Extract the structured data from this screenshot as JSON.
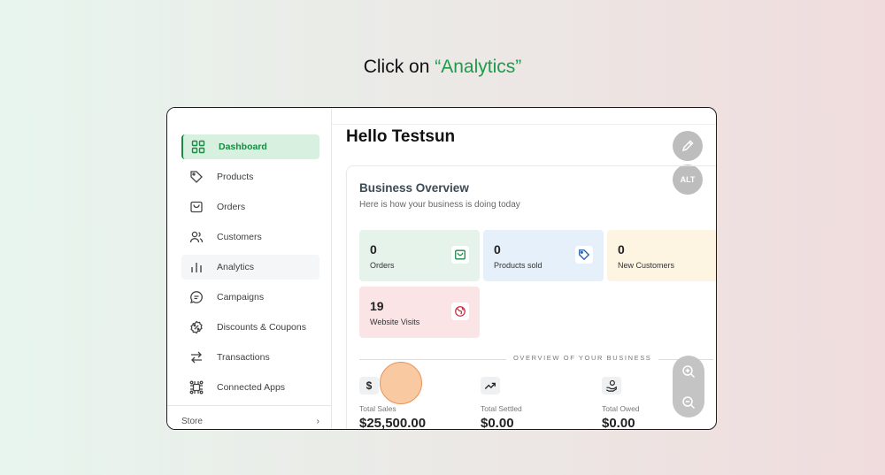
{
  "instruction": {
    "prefix": "Click on ",
    "target": "“Analytics”"
  },
  "sidebar": {
    "items": [
      {
        "label": "Dashboard",
        "icon": "grid-icon"
      },
      {
        "label": "Products",
        "icon": "tag-icon"
      },
      {
        "label": "Orders",
        "icon": "shopping-bag-icon"
      },
      {
        "label": "Customers",
        "icon": "users-icon"
      },
      {
        "label": "Analytics",
        "icon": "bar-chart-icon"
      },
      {
        "label": "Campaigns",
        "icon": "chat-bubble-icon"
      },
      {
        "label": "Discounts & Coupons",
        "icon": "discount-badge-icon"
      },
      {
        "label": "Transactions",
        "icon": "arrows-exchange-icon"
      },
      {
        "label": "Connected Apps",
        "icon": "apps-icon"
      }
    ],
    "store_label": "Store",
    "store_chevron": "›"
  },
  "main": {
    "title": "Hello Testsun",
    "alt_label": "ALT",
    "overview": {
      "title": "Business Overview",
      "subtitle": "Here is how your business is doing today",
      "stats": [
        {
          "value": "0",
          "label": "Orders",
          "bg": "#e5f3eb",
          "icon": "shopping-bag-icon"
        },
        {
          "value": "0",
          "label": "Products sold",
          "bg": "#e6f0fb",
          "icon": "tag-icon"
        },
        {
          "value": "0",
          "label": "New Customers",
          "bg": "#fdf5e2",
          "icon": "user-circle-icon"
        },
        {
          "value": "19",
          "label": "Website Visits",
          "bg": "#fbe4e6",
          "icon": "globe-icon"
        }
      ],
      "section_label": "OVERVIEW OF YOUR BUSINESS",
      "totals": [
        {
          "label": "Total Sales",
          "value": "$25,500.00",
          "icon": "dollar-icon",
          "glyph": "$"
        },
        {
          "label": "Total Settled",
          "value": "$0.00",
          "icon": "trend-up-icon"
        },
        {
          "label": "Total Owed",
          "value": "$0.00",
          "icon": "hand-coin-icon"
        }
      ]
    }
  },
  "colors": {
    "accent": "#1a8a43",
    "instruction_highlight": "#1e9a4b",
    "click_marker": "#f6ac6e"
  }
}
